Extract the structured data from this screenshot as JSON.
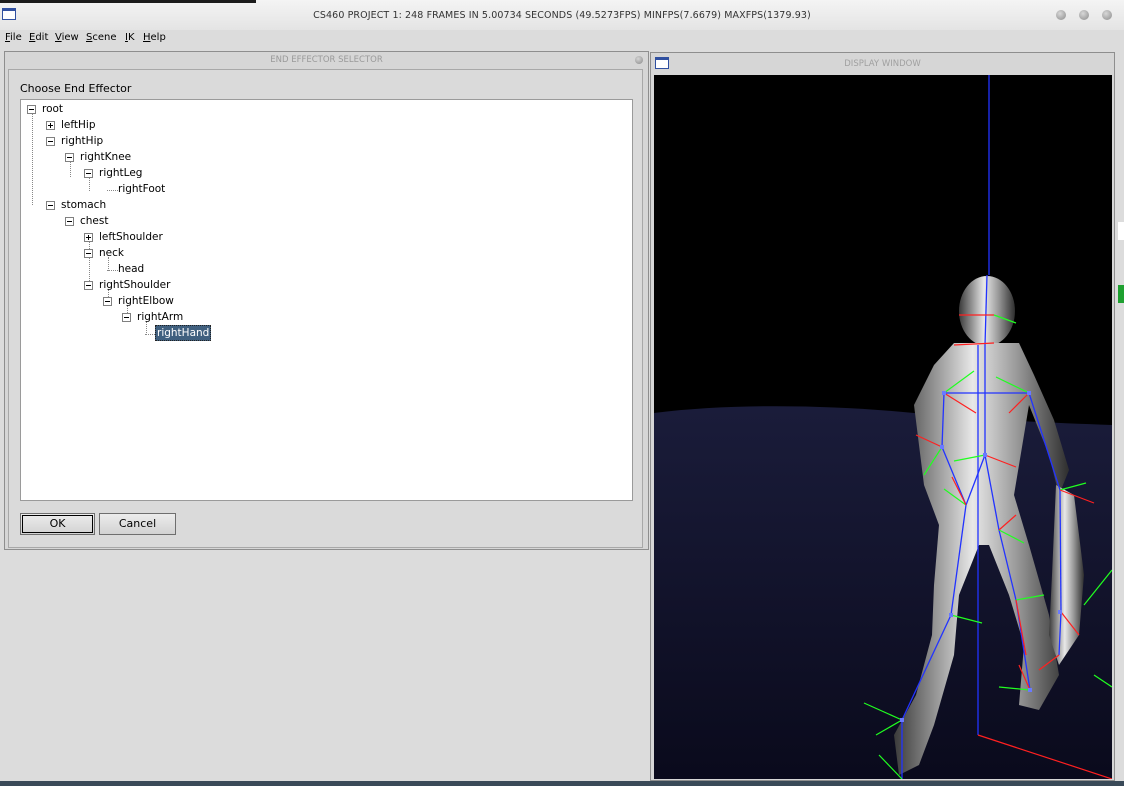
{
  "window": {
    "title": "CS460 PROJECT 1: 248 FRAMES IN 5.00734 SECONDS (49.5273FPS) MINFPS(7.6679) MAXFPS(1379.93)",
    "icon": "app-window-icon"
  },
  "menu": {
    "items": [
      "File",
      "Edit",
      "View",
      "Scene",
      "IK",
      "Help"
    ]
  },
  "selector": {
    "title": "END EFFECTOR SELECTOR",
    "label": "Choose End Effector",
    "tree": [
      {
        "label": "root",
        "expander": "minus"
      },
      {
        "label": "leftHip",
        "expander": "plus"
      },
      {
        "label": "rightHip",
        "expander": "minus"
      },
      {
        "label": "rightKnee",
        "expander": "minus"
      },
      {
        "label": "rightLeg",
        "expander": "minus"
      },
      {
        "label": "rightFoot",
        "expander": "none"
      },
      {
        "label": "stomach",
        "expander": "minus"
      },
      {
        "label": "chest",
        "expander": "minus"
      },
      {
        "label": "leftShoulder",
        "expander": "plus"
      },
      {
        "label": "neck",
        "expander": "minus"
      },
      {
        "label": "head",
        "expander": "none"
      },
      {
        "label": "rightShoulder",
        "expander": "minus"
      },
      {
        "label": "rightElbow",
        "expander": "minus"
      },
      {
        "label": "rightArm",
        "expander": "minus"
      },
      {
        "label": "rightHand",
        "expander": "none",
        "selected": true
      }
    ],
    "ok_label": "OK",
    "cancel_label": "Cancel"
  },
  "display": {
    "title": "DISPLAY WINDOW"
  },
  "colors": {
    "selected_bg": "#40607f",
    "canvas_bg": "#000000",
    "floor": "#11132a",
    "bone": "#2233ff",
    "axis_red": "#ff2020",
    "axis_green": "#20ff20",
    "figure": "#9a9a9a"
  }
}
